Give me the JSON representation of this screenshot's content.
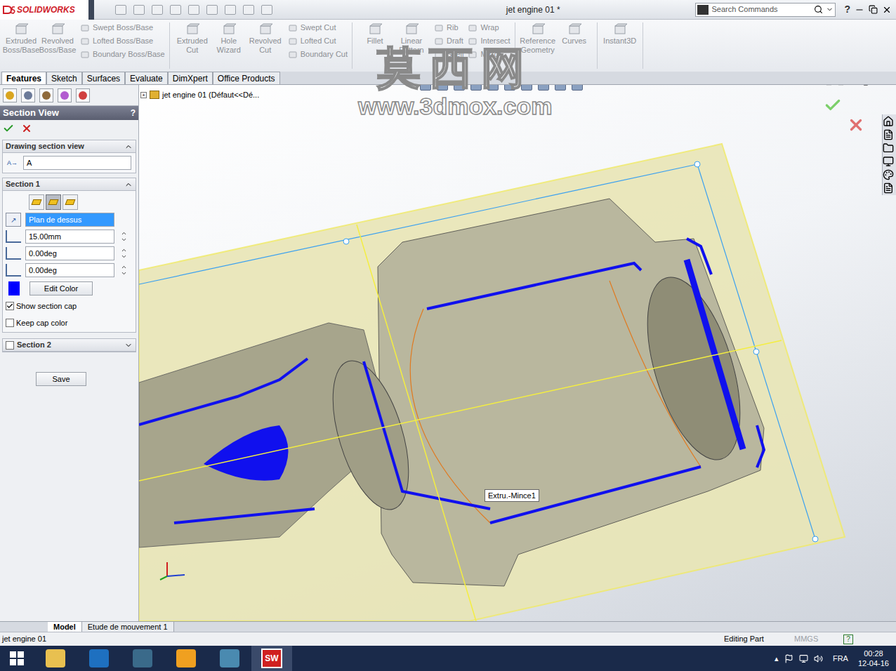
{
  "window": {
    "app": "SOLIDWORKS",
    "title": "jet engine 01 *"
  },
  "search": {
    "placeholder": "Search Commands",
    "help": "?"
  },
  "ribbon_groups": [
    {
      "disabled": true,
      "large": [
        "Extruded Boss/Base",
        "Revolved Boss/Base"
      ],
      "small_columns": [
        [
          "Swept Boss/Base",
          "Lofted Boss/Base",
          "Boundary Boss/Base"
        ]
      ]
    },
    {
      "disabled": true,
      "large": [
        "Extruded Cut",
        "Hole Wizard",
        "Revolved Cut"
      ],
      "small_columns": [
        [
          "Swept Cut",
          "Lofted Cut",
          "Boundary Cut"
        ]
      ]
    },
    {
      "disabled": true,
      "large": [
        "Fillet",
        "Linear Pattern"
      ],
      "small_columns": [
        [
          "Rib",
          "Draft",
          "Shell"
        ],
        [
          "Wrap",
          "Intersect",
          "Mirror"
        ]
      ]
    },
    {
      "disabled": true,
      "large": [
        "Reference Geometry",
        "Curves"
      ],
      "small_columns": []
    },
    {
      "disabled": true,
      "large": [
        "Instant3D"
      ],
      "small_columns": []
    }
  ],
  "tabs": [
    {
      "label": "Features",
      "selected": true
    },
    {
      "label": "Sketch",
      "selected": false
    },
    {
      "label": "Surfaces",
      "selected": false
    },
    {
      "label": "Evaluate",
      "selected": false
    },
    {
      "label": "DimXpert",
      "selected": false
    },
    {
      "label": "Office Products",
      "selected": false
    }
  ],
  "property_manager": {
    "title": "Section View",
    "help": "?",
    "drawing_section": {
      "title": "Drawing section view",
      "expanded": true,
      "value": "A"
    },
    "section1": {
      "title": "Section 1",
      "expanded": true,
      "plane_buttons": [
        {
          "selected": false
        },
        {
          "selected": true
        },
        {
          "selected": false
        }
      ],
      "reference": "Plan de dessus",
      "reference_selected": true,
      "offset": "15.00mm",
      "angle_x": "0.00deg",
      "angle_y": "0.00deg",
      "cap_color": "#0000ff",
      "edit_color": "Edit Color",
      "show_cap": {
        "label": "Show section cap",
        "checked": true
      },
      "keep_color": {
        "label": "Keep cap color",
        "checked": false
      }
    },
    "section2": {
      "title": "Section 2",
      "checked": false,
      "expanded": false
    },
    "save": "Save"
  },
  "tree": {
    "root": "jet engine 01  (Défaut<<Dé...",
    "expanded": false
  },
  "watermark": {
    "title": "莫西网",
    "url": "www.3dmox.com"
  },
  "tooltip": "Extru.-Mince1",
  "bottom_tabs": [
    {
      "label": "Model",
      "selected": true
    },
    {
      "label": "Etude de mouvement 1",
      "selected": false
    }
  ],
  "status_bar": {
    "document": "jet engine 01",
    "mode": "Editing Part",
    "units": "MMGS",
    "help": "?"
  },
  "taskbar": {
    "active_app": "SW",
    "language": "FRA",
    "time": "00:28",
    "date": "12-04-16"
  }
}
